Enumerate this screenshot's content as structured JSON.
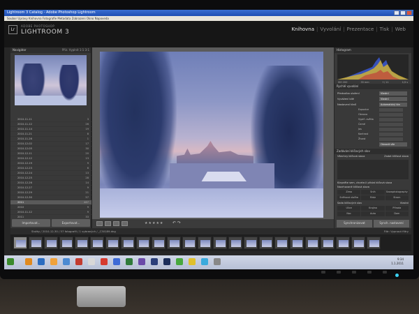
{
  "window": {
    "title": "Lightroom 3 Catalog - Adobe Photoshop Lightroom",
    "menus": "Soubor  Upravy  Knihovna  Fotografie  Metadata  Zobrazeni  Okno  Napoveda"
  },
  "brand": {
    "logo": "Lr",
    "small": "ADOBE PHOTOSHOP",
    "name": "LIGHTROOM 3"
  },
  "modules": [
    "Knihovna",
    "Vyvolání",
    "Prezentace",
    "Tisk",
    "Web"
  ],
  "left_panel": {
    "navigator": "Navigátor",
    "nav_opts": "Přiz.  Vyplnit  1:1  3:1",
    "folders": [
      {
        "name": "2010-11-11",
        "count": "3"
      },
      {
        "name": "2010-11-12",
        "count": "26"
      },
      {
        "name": "2010-11-14",
        "count": "19"
      },
      {
        "name": "2010-11-21",
        "count": "8"
      },
      {
        "name": "2010-11-26",
        "count": "1"
      },
      {
        "name": "2010-12-02",
        "count": "17"
      },
      {
        "name": "2010-12-05",
        "count": "30"
      },
      {
        "name": "2010-12-11",
        "count": "20"
      },
      {
        "name": "2010-12-12",
        "count": "13"
      },
      {
        "name": "2010-12-19",
        "count": "9"
      },
      {
        "name": "2010-12-23",
        "count": "6"
      },
      {
        "name": "2010-12-24",
        "count": "13"
      },
      {
        "name": "2010-12-25",
        "count": "28"
      },
      {
        "name": "2010-12-26",
        "count": "14"
      },
      {
        "name": "2010-12-27",
        "count": "9"
      },
      {
        "name": "2010-12-29",
        "count": "21"
      },
      {
        "name": "2010-12-30",
        "count": "57"
      },
      {
        "name": "2011",
        "count": "467"
      },
      {
        "name": "2010",
        "count": "9"
      },
      {
        "name": "2010-11-12",
        "count": "9"
      },
      {
        "name": "2011",
        "count": "33"
      }
    ],
    "import_btn": "Importovat...",
    "export_btn": "Exportovat..."
  },
  "toolbar": {
    "stars": "★★★★★"
  },
  "right_panel": {
    "histogram": "Histogram",
    "histo_labels": [
      "ISO 200",
      "35 mm",
      "f / 11",
      "1/3 s"
    ],
    "quick_develop": "Rychlé vyvolání",
    "rows": [
      {
        "label": "Předvolba uložení",
        "value": "Vlastní"
      },
      {
        "label": "Vyvážení bílé",
        "value": "Vlastní"
      },
      {
        "label": "Nastavení tónů",
        "value": "Automatický tón"
      }
    ],
    "tone_rows": [
      "Expozice",
      "Obnova",
      "Vyplň. světla",
      "Černé",
      "Jas",
      "Kontrast",
      "Živost"
    ],
    "reset": "Obnovit vše",
    "keywords": "Zadávání klíčových slov",
    "kw_tags": "Všechny klíčová slova",
    "kw_enter": "Zadat klíčová slova",
    "kw_hint": "Klepněte sem, chcete-li přidat klíčová slova",
    "kw_suggest": "Navrhované klíčová slova",
    "kw_grid": [
      "Zima",
      "Sníh",
      "Snowphotography",
      "Sněhová vločka",
      "Mráz",
      "Strom"
    ],
    "kw_set": "Sada klíčových slov",
    "kw_set_value": "Vlastní",
    "kw_set_grid": [
      "Ulice",
      "Krajina",
      "Příroda",
      "Noc",
      "Auta",
      "Dom"
    ],
    "sync_meta": "Synchronizovat",
    "sync_set": "Synch. nastavení"
  },
  "filmstrip": {
    "path": "Složky / 2010-12-30 / 57 fotografií / 1 vybraných / _C30189.dng",
    "filter": "Filtr:",
    "filter_value": "Vypnout filtry",
    "thumbs": 24,
    "selected_index": 0
  },
  "taskbar": {
    "time": "9:34",
    "date": "1.1.2011"
  }
}
